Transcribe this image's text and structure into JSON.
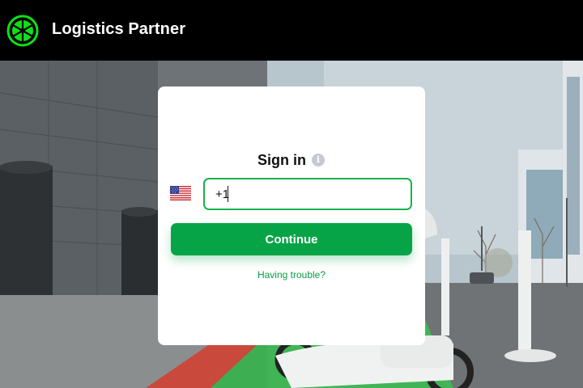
{
  "header": {
    "brand": "Logistics Partner",
    "logo_icon": "lime-wheel-logo",
    "background": "#000000",
    "logo_color": "#0ee019"
  },
  "signin": {
    "title": "Sign in",
    "info_icon": "info-icon",
    "country_flag": "us-flag-icon",
    "phone_value": "+1",
    "continue_label": "Continue",
    "trouble_label": "Having trouble?"
  },
  "colors": {
    "accent": "#07a447",
    "input_border": "#14b34a",
    "link": "#0a9b45"
  }
}
